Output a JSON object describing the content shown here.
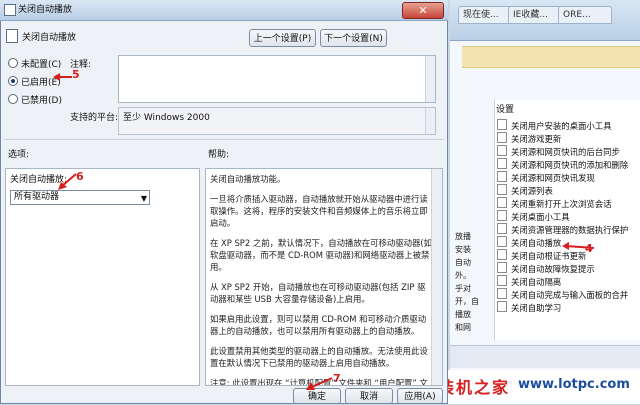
{
  "background_window": {
    "tabs": [
      "现在使...",
      "IE收藏...",
      "ORE..."
    ],
    "list_header": "设置",
    "items": [
      "关闭用户安装的桌面小工具",
      "关闭游戏更新",
      "关闭源和网页快讯的后台同步",
      "关闭源和网页快讯的添加和删除",
      "关闭源和网页快讯发现",
      "关闭源列表",
      "关闭重新打开上次浏览会话",
      "关闭桌面小工具",
      "关闭资源管理器的数据执行保护",
      "关闭自动播放",
      "关闭自动根证书更新",
      "关闭自动故障恢复提示",
      "关闭自动隔离",
      "关闭自动完成与输入面板的合并",
      "关闭自助学习"
    ],
    "left_strip": [
      "放播",
      "安装",
      "自动",
      "外。",
      "乎对",
      "开，自",
      "播放",
      "和网"
    ]
  },
  "dialog": {
    "title": "关闭自动播放",
    "close_label": "✕",
    "header_title": "关闭自动播放",
    "prev_button": "上一个设置(P)",
    "next_button": "下一个设置(N)",
    "radio_not_configured": "未配置(C)",
    "radio_enabled": "已启用(E)",
    "radio_disabled": "已禁用(D)",
    "comment_label": "注释:",
    "platform_label": "支持的平台:",
    "platform_value": "至少 Windows 2000",
    "options_label": "选项:",
    "help_label": "帮助:",
    "option_title": "关闭自动播放:",
    "dropdown_value": "所有驱动器",
    "help_paragraphs": [
      "关闭自动播放功能。",
      "一旦将介质插入驱动器，自动播放就开始从驱动器中进行读取操作。这将，程序的安装文件和音频媒体上的音乐将立即启动。",
      "在 XP SP2 之前，默认情况下，自动播放在可移动驱动器(如软盘驱动器，而不是 CD-ROM 驱动器)和网络驱动器上被禁用。",
      "从 XP SP2 开始，自动播放也在可移动驱动器(包括 ZIP 驱动器和某些 USB 大容量存储设备)上启用。",
      "如果启用此设置，则可以禁用 CD-ROM 和可移动介质驱动器上的自动播放，也可以禁用所有驱动器上的自动播放。",
      "此设置禁用其他类型的驱动器上的自动播放。无法使用此设置在默认情况下已禁用的驱动器上启用自动播放。",
      "注意: 此设置出现在 “计算机配置” 文件夹和 “用户配置” 文件夹"
    ],
    "ok_button": "确定",
    "cancel_button": "取消",
    "apply_button": "应用(A)"
  },
  "annotations": [
    "4",
    "5",
    "6",
    "7"
  ],
  "watermark": {
    "cn": "装机之家",
    "url": "www.lotpc.com"
  }
}
